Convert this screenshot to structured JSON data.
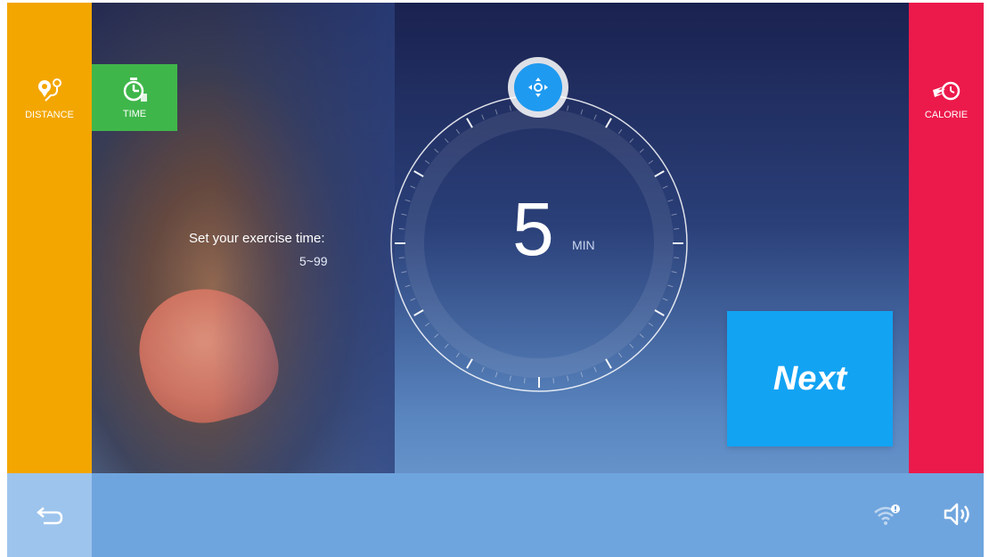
{
  "modes": {
    "distance": {
      "label": "DISTANCE",
      "icon": "map-pin-route-icon"
    },
    "time": {
      "label": "TIME",
      "icon": "stopwatch-icon"
    },
    "calorie": {
      "label": "CALORIE",
      "icon": "flame-clock-icon"
    }
  },
  "setting": {
    "prompt": "Set your exercise time:",
    "range": "5~99",
    "value": "5",
    "unit": "MIN",
    "knob_icon": "drag-handle-icon"
  },
  "actions": {
    "next_label": "Next"
  },
  "bottom_bar": {
    "back_icon": "back-arrow-icon",
    "wifi_icon": "wifi-alert-icon",
    "volume_icon": "speaker-icon"
  },
  "colors": {
    "distance": "#f3a600",
    "time": "#3fb64a",
    "calorie": "#ec1a4b",
    "next": "#13a3f3",
    "knob": "#1e9af0"
  }
}
